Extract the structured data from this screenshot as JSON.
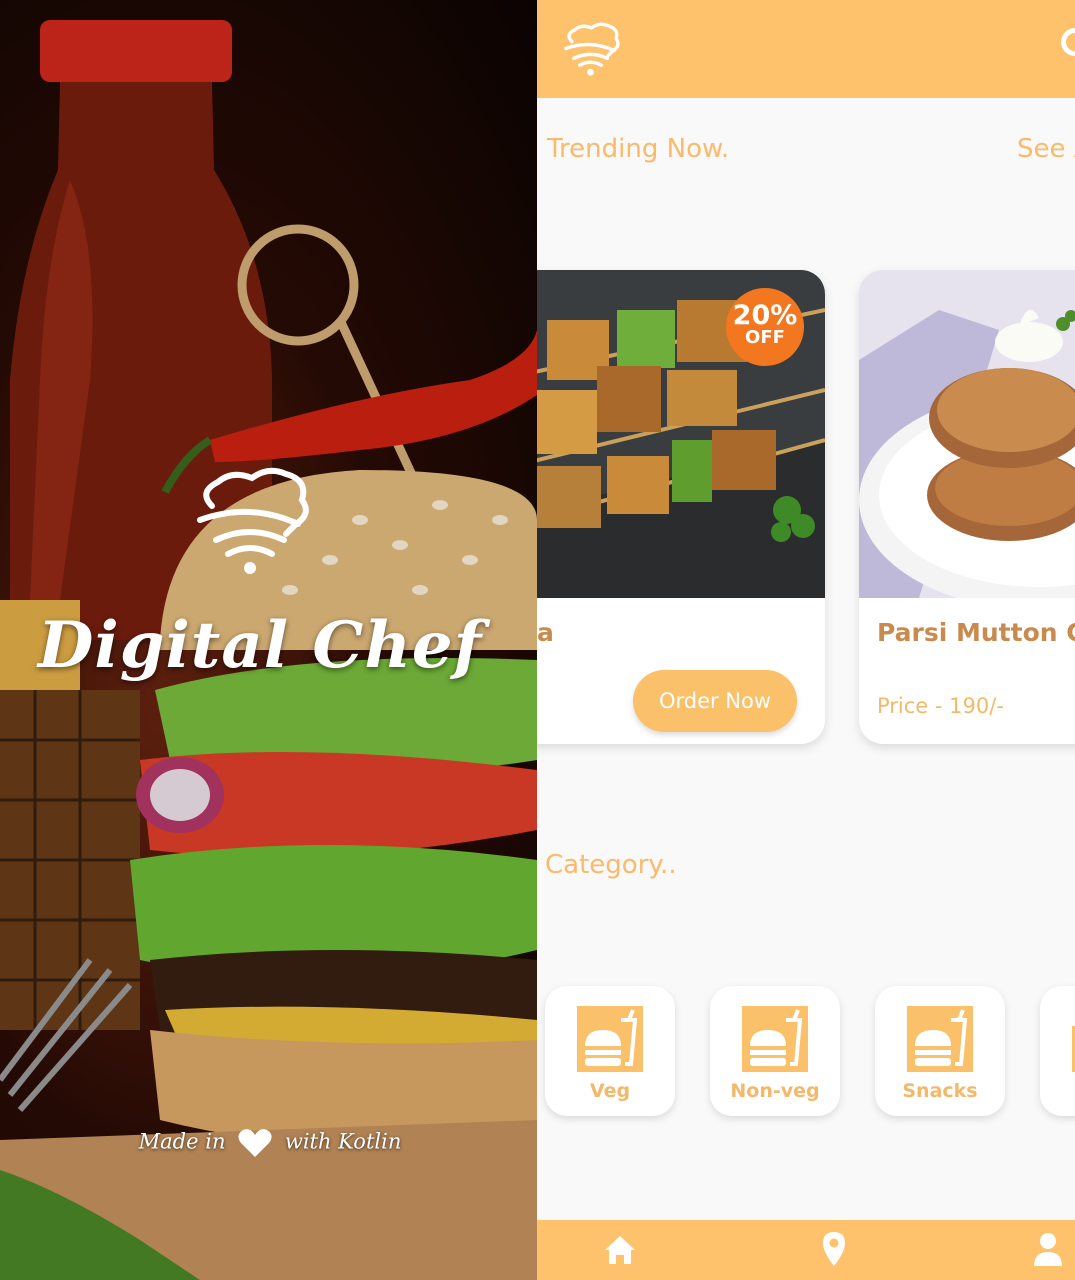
{
  "splash": {
    "app_name": "Digital Chef",
    "made_in_prefix": "Made in",
    "made_in_suffix": "with Kotlin"
  },
  "home": {
    "trending_title": "Trending Now.",
    "see_all": "See All",
    "cards": [
      {
        "name_fragment": "a",
        "discount_percent": "20%",
        "discount_off": "OFF",
        "order_button": "Order Now"
      },
      {
        "name": "Parsi Mutton Cutlet",
        "price": "Price - 190/-"
      }
    ],
    "category_title": "Category..",
    "categories": [
      "Veg",
      "Non-veg",
      "Snacks"
    ],
    "bottom_nav": [
      "home-icon",
      "location-icon",
      "profile-icon"
    ]
  },
  "colors": {
    "accent": "#fec16c",
    "accent_text": "#fbb96a",
    "title_brown": "#c98a4e",
    "discount": "#f3771f"
  }
}
